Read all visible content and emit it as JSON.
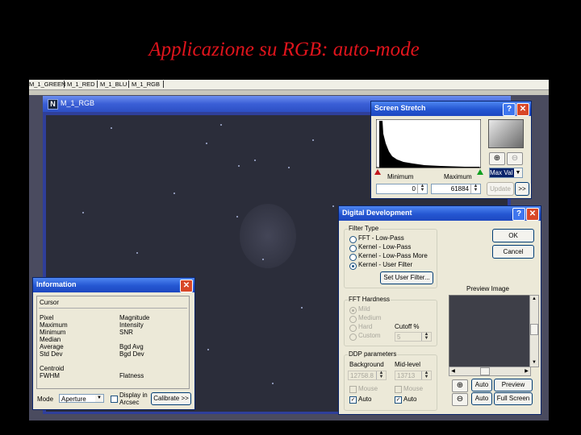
{
  "slide": {
    "title": "Applicazione su RGB: auto-mode"
  },
  "tabs": [
    "M_1_GREEN",
    "M_1_RED",
    "M_1_BLU",
    "M_1_RGB"
  ],
  "image_window": {
    "title": "M_1_RGB",
    "icon": "N"
  },
  "screen_stretch": {
    "title": "Screen Stretch",
    "minimum_label": "Minimum",
    "maximum_label": "Maximum",
    "minimum_value": "0",
    "maximum_value": "61884",
    "mode_value": "Max Val",
    "update_label": "Update",
    "more_label": ">>"
  },
  "digital_development": {
    "title": "Digital Development",
    "filter_type": {
      "label": "Filter Type",
      "options": [
        "FFT - Low-Pass",
        "Kernel - Low-Pass",
        "Kernel - Low-Pass More",
        "Kernel - User Filter"
      ],
      "selected": 3,
      "set_user_filter_label": "Set User Filter..."
    },
    "ok_label": "OK",
    "cancel_label": "Cancel",
    "fft_hardness": {
      "label": "FFT Hardness",
      "options": [
        "Mild",
        "Medium",
        "Hard",
        "Custom"
      ],
      "cutoff_label": "Cutoff %",
      "cutoff_value": "5"
    },
    "ddp": {
      "label": "DDP parameters",
      "background_label": "Background",
      "midlevel_label": "Mid-level",
      "background_value": "12758.8",
      "midlevel_value": "13713",
      "mouse_label": "Mouse",
      "auto_label": "Auto"
    },
    "preview_label": "Preview Image",
    "auto_btn": "Auto",
    "preview_btn": "Preview",
    "fullscreen_btn": "Full Screen"
  },
  "information": {
    "title": "Information",
    "cursor_label": "Cursor",
    "left_labels": [
      "Pixel",
      "Maximum",
      "Minimum",
      "Median",
      "Average",
      "Std Dev"
    ],
    "right_labels": [
      "Magnitude",
      "Intensity",
      "SNR",
      "Bgd Avg",
      "Bgd Dev"
    ],
    "centroid_label": "Centroid",
    "fwhm_label": "FWHM",
    "flatness_label": "Flatness",
    "mode_label": "Mode",
    "mode_value": "Aperture",
    "display_arcsec_label": "Display in",
    "display_arcsec_label2": "Arcsec",
    "calibrate_label": "Calibrate >>"
  }
}
